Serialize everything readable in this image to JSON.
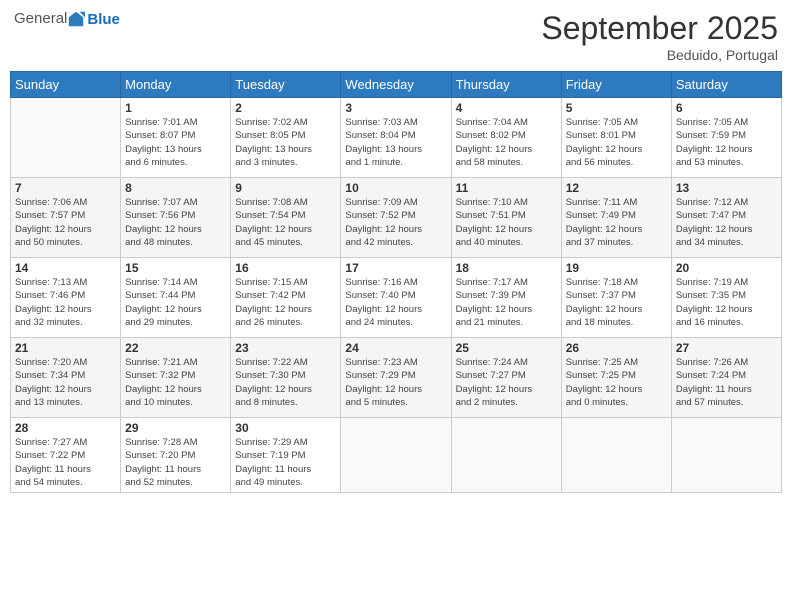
{
  "header": {
    "logo_general": "General",
    "logo_blue": "Blue",
    "month": "September 2025",
    "location": "Beduido, Portugal"
  },
  "weekdays": [
    "Sunday",
    "Monday",
    "Tuesday",
    "Wednesday",
    "Thursday",
    "Friday",
    "Saturday"
  ],
  "weeks": [
    [
      {
        "day": "",
        "info": ""
      },
      {
        "day": "1",
        "info": "Sunrise: 7:01 AM\nSunset: 8:07 PM\nDaylight: 13 hours\nand 6 minutes."
      },
      {
        "day": "2",
        "info": "Sunrise: 7:02 AM\nSunset: 8:05 PM\nDaylight: 13 hours\nand 3 minutes."
      },
      {
        "day": "3",
        "info": "Sunrise: 7:03 AM\nSunset: 8:04 PM\nDaylight: 13 hours\nand 1 minute."
      },
      {
        "day": "4",
        "info": "Sunrise: 7:04 AM\nSunset: 8:02 PM\nDaylight: 12 hours\nand 58 minutes."
      },
      {
        "day": "5",
        "info": "Sunrise: 7:05 AM\nSunset: 8:01 PM\nDaylight: 12 hours\nand 56 minutes."
      },
      {
        "day": "6",
        "info": "Sunrise: 7:05 AM\nSunset: 7:59 PM\nDaylight: 12 hours\nand 53 minutes."
      }
    ],
    [
      {
        "day": "7",
        "info": "Sunrise: 7:06 AM\nSunset: 7:57 PM\nDaylight: 12 hours\nand 50 minutes."
      },
      {
        "day": "8",
        "info": "Sunrise: 7:07 AM\nSunset: 7:56 PM\nDaylight: 12 hours\nand 48 minutes."
      },
      {
        "day": "9",
        "info": "Sunrise: 7:08 AM\nSunset: 7:54 PM\nDaylight: 12 hours\nand 45 minutes."
      },
      {
        "day": "10",
        "info": "Sunrise: 7:09 AM\nSunset: 7:52 PM\nDaylight: 12 hours\nand 42 minutes."
      },
      {
        "day": "11",
        "info": "Sunrise: 7:10 AM\nSunset: 7:51 PM\nDaylight: 12 hours\nand 40 minutes."
      },
      {
        "day": "12",
        "info": "Sunrise: 7:11 AM\nSunset: 7:49 PM\nDaylight: 12 hours\nand 37 minutes."
      },
      {
        "day": "13",
        "info": "Sunrise: 7:12 AM\nSunset: 7:47 PM\nDaylight: 12 hours\nand 34 minutes."
      }
    ],
    [
      {
        "day": "14",
        "info": "Sunrise: 7:13 AM\nSunset: 7:46 PM\nDaylight: 12 hours\nand 32 minutes."
      },
      {
        "day": "15",
        "info": "Sunrise: 7:14 AM\nSunset: 7:44 PM\nDaylight: 12 hours\nand 29 minutes."
      },
      {
        "day": "16",
        "info": "Sunrise: 7:15 AM\nSunset: 7:42 PM\nDaylight: 12 hours\nand 26 minutes."
      },
      {
        "day": "17",
        "info": "Sunrise: 7:16 AM\nSunset: 7:40 PM\nDaylight: 12 hours\nand 24 minutes."
      },
      {
        "day": "18",
        "info": "Sunrise: 7:17 AM\nSunset: 7:39 PM\nDaylight: 12 hours\nand 21 minutes."
      },
      {
        "day": "19",
        "info": "Sunrise: 7:18 AM\nSunset: 7:37 PM\nDaylight: 12 hours\nand 18 minutes."
      },
      {
        "day": "20",
        "info": "Sunrise: 7:19 AM\nSunset: 7:35 PM\nDaylight: 12 hours\nand 16 minutes."
      }
    ],
    [
      {
        "day": "21",
        "info": "Sunrise: 7:20 AM\nSunset: 7:34 PM\nDaylight: 12 hours\nand 13 minutes."
      },
      {
        "day": "22",
        "info": "Sunrise: 7:21 AM\nSunset: 7:32 PM\nDaylight: 12 hours\nand 10 minutes."
      },
      {
        "day": "23",
        "info": "Sunrise: 7:22 AM\nSunset: 7:30 PM\nDaylight: 12 hours\nand 8 minutes."
      },
      {
        "day": "24",
        "info": "Sunrise: 7:23 AM\nSunset: 7:29 PM\nDaylight: 12 hours\nand 5 minutes."
      },
      {
        "day": "25",
        "info": "Sunrise: 7:24 AM\nSunset: 7:27 PM\nDaylight: 12 hours\nand 2 minutes."
      },
      {
        "day": "26",
        "info": "Sunrise: 7:25 AM\nSunset: 7:25 PM\nDaylight: 12 hours\nand 0 minutes."
      },
      {
        "day": "27",
        "info": "Sunrise: 7:26 AM\nSunset: 7:24 PM\nDaylight: 11 hours\nand 57 minutes."
      }
    ],
    [
      {
        "day": "28",
        "info": "Sunrise: 7:27 AM\nSunset: 7:22 PM\nDaylight: 11 hours\nand 54 minutes."
      },
      {
        "day": "29",
        "info": "Sunrise: 7:28 AM\nSunset: 7:20 PM\nDaylight: 11 hours\nand 52 minutes."
      },
      {
        "day": "30",
        "info": "Sunrise: 7:29 AM\nSunset: 7:19 PM\nDaylight: 11 hours\nand 49 minutes."
      },
      {
        "day": "",
        "info": ""
      },
      {
        "day": "",
        "info": ""
      },
      {
        "day": "",
        "info": ""
      },
      {
        "day": "",
        "info": ""
      }
    ]
  ]
}
